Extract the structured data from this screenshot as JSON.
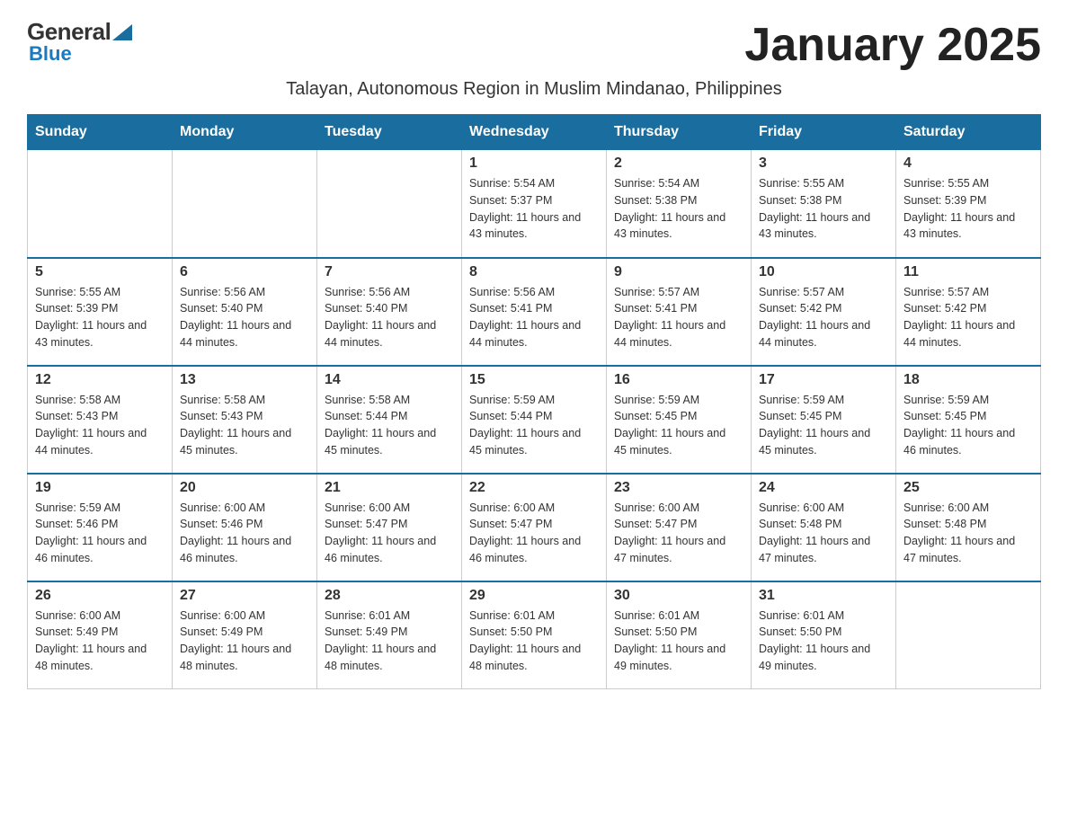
{
  "logo": {
    "general": "General",
    "blue": "Blue"
  },
  "title": "January 2025",
  "subtitle": "Talayan, Autonomous Region in Muslim Mindanao, Philippines",
  "header_color": "#1a6e9f",
  "days_of_week": [
    "Sunday",
    "Monday",
    "Tuesday",
    "Wednesday",
    "Thursday",
    "Friday",
    "Saturday"
  ],
  "weeks": [
    {
      "days": [
        {
          "date": "",
          "info": ""
        },
        {
          "date": "",
          "info": ""
        },
        {
          "date": "",
          "info": ""
        },
        {
          "date": "1",
          "sunrise": "5:54 AM",
          "sunset": "5:37 PM",
          "daylight": "11 hours and 43 minutes."
        },
        {
          "date": "2",
          "sunrise": "5:54 AM",
          "sunset": "5:38 PM",
          "daylight": "11 hours and 43 minutes."
        },
        {
          "date": "3",
          "sunrise": "5:55 AM",
          "sunset": "5:38 PM",
          "daylight": "11 hours and 43 minutes."
        },
        {
          "date": "4",
          "sunrise": "5:55 AM",
          "sunset": "5:39 PM",
          "daylight": "11 hours and 43 minutes."
        }
      ]
    },
    {
      "days": [
        {
          "date": "5",
          "sunrise": "5:55 AM",
          "sunset": "5:39 PM",
          "daylight": "11 hours and 43 minutes."
        },
        {
          "date": "6",
          "sunrise": "5:56 AM",
          "sunset": "5:40 PM",
          "daylight": "11 hours and 44 minutes."
        },
        {
          "date": "7",
          "sunrise": "5:56 AM",
          "sunset": "5:40 PM",
          "daylight": "11 hours and 44 minutes."
        },
        {
          "date": "8",
          "sunrise": "5:56 AM",
          "sunset": "5:41 PM",
          "daylight": "11 hours and 44 minutes."
        },
        {
          "date": "9",
          "sunrise": "5:57 AM",
          "sunset": "5:41 PM",
          "daylight": "11 hours and 44 minutes."
        },
        {
          "date": "10",
          "sunrise": "5:57 AM",
          "sunset": "5:42 PM",
          "daylight": "11 hours and 44 minutes."
        },
        {
          "date": "11",
          "sunrise": "5:57 AM",
          "sunset": "5:42 PM",
          "daylight": "11 hours and 44 minutes."
        }
      ]
    },
    {
      "days": [
        {
          "date": "12",
          "sunrise": "5:58 AM",
          "sunset": "5:43 PM",
          "daylight": "11 hours and 44 minutes."
        },
        {
          "date": "13",
          "sunrise": "5:58 AM",
          "sunset": "5:43 PM",
          "daylight": "11 hours and 45 minutes."
        },
        {
          "date": "14",
          "sunrise": "5:58 AM",
          "sunset": "5:44 PM",
          "daylight": "11 hours and 45 minutes."
        },
        {
          "date": "15",
          "sunrise": "5:59 AM",
          "sunset": "5:44 PM",
          "daylight": "11 hours and 45 minutes."
        },
        {
          "date": "16",
          "sunrise": "5:59 AM",
          "sunset": "5:45 PM",
          "daylight": "11 hours and 45 minutes."
        },
        {
          "date": "17",
          "sunrise": "5:59 AM",
          "sunset": "5:45 PM",
          "daylight": "11 hours and 45 minutes."
        },
        {
          "date": "18",
          "sunrise": "5:59 AM",
          "sunset": "5:45 PM",
          "daylight": "11 hours and 46 minutes."
        }
      ]
    },
    {
      "days": [
        {
          "date": "19",
          "sunrise": "5:59 AM",
          "sunset": "5:46 PM",
          "daylight": "11 hours and 46 minutes."
        },
        {
          "date": "20",
          "sunrise": "6:00 AM",
          "sunset": "5:46 PM",
          "daylight": "11 hours and 46 minutes."
        },
        {
          "date": "21",
          "sunrise": "6:00 AM",
          "sunset": "5:47 PM",
          "daylight": "11 hours and 46 minutes."
        },
        {
          "date": "22",
          "sunrise": "6:00 AM",
          "sunset": "5:47 PM",
          "daylight": "11 hours and 46 minutes."
        },
        {
          "date": "23",
          "sunrise": "6:00 AM",
          "sunset": "5:47 PM",
          "daylight": "11 hours and 47 minutes."
        },
        {
          "date": "24",
          "sunrise": "6:00 AM",
          "sunset": "5:48 PM",
          "daylight": "11 hours and 47 minutes."
        },
        {
          "date": "25",
          "sunrise": "6:00 AM",
          "sunset": "5:48 PM",
          "daylight": "11 hours and 47 minutes."
        }
      ]
    },
    {
      "days": [
        {
          "date": "26",
          "sunrise": "6:00 AM",
          "sunset": "5:49 PM",
          "daylight": "11 hours and 48 minutes."
        },
        {
          "date": "27",
          "sunrise": "6:00 AM",
          "sunset": "5:49 PM",
          "daylight": "11 hours and 48 minutes."
        },
        {
          "date": "28",
          "sunrise": "6:01 AM",
          "sunset": "5:49 PM",
          "daylight": "11 hours and 48 minutes."
        },
        {
          "date": "29",
          "sunrise": "6:01 AM",
          "sunset": "5:50 PM",
          "daylight": "11 hours and 48 minutes."
        },
        {
          "date": "30",
          "sunrise": "6:01 AM",
          "sunset": "5:50 PM",
          "daylight": "11 hours and 49 minutes."
        },
        {
          "date": "31",
          "sunrise": "6:01 AM",
          "sunset": "5:50 PM",
          "daylight": "11 hours and 49 minutes."
        },
        {
          "date": "",
          "info": ""
        }
      ]
    }
  ]
}
